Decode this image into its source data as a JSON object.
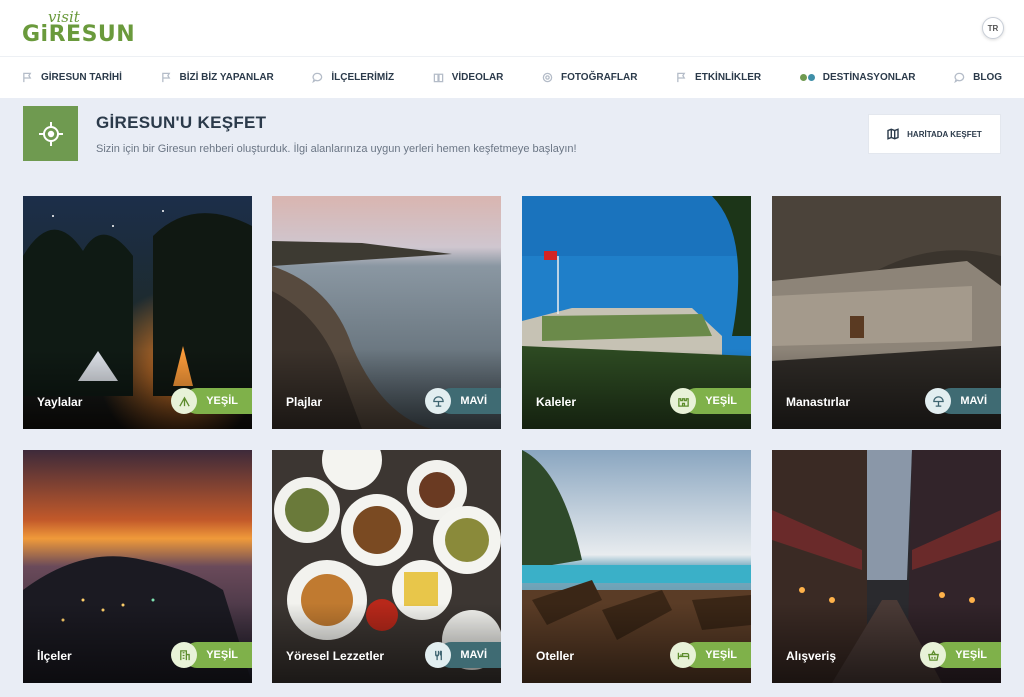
{
  "header": {
    "logo_script": "visit",
    "logo_brand": "GiRESUN",
    "lang": "TR"
  },
  "nav": {
    "items": [
      {
        "label": "GİRESUN TARİHİ",
        "icon": "flag-icon"
      },
      {
        "label": "BİZİ BİZ YAPANLAR",
        "icon": "flag-icon"
      },
      {
        "label": "İLÇELERİMİZ",
        "icon": "chat-icon"
      },
      {
        "label": "VİDEOLAR",
        "icon": "book-icon"
      },
      {
        "label": "FOTOĞRAFLAR",
        "icon": "camera-icon"
      },
      {
        "label": "ETKİNLİKLER",
        "icon": "flag-icon"
      },
      {
        "label": "DESTİNASYONLAR",
        "icon": "dots-icon"
      },
      {
        "label": "BLOG",
        "icon": "chat-icon"
      }
    ]
  },
  "page": {
    "title": "GİRESUN'U KEŞFET",
    "subtitle": "Sizin için bir Giresun rehberi oluşturduk. İlgi alanlarınıza uygun yerleri hemen keşfetmeye başlayın!",
    "map_button": "HARİTADA KEŞFET"
  },
  "colors": {
    "green": "#7fb14a",
    "blue": "#3f6b73",
    "hero": "#6f9a50",
    "bg": "#e9edf5"
  },
  "cards": [
    {
      "label": "Yaylalar",
      "badge": "YEŞİL",
      "tone": "green",
      "icon": "tent-icon"
    },
    {
      "label": "Plajlar",
      "badge": "MAVİ",
      "tone": "blue",
      "icon": "umbrella-icon"
    },
    {
      "label": "Kaleler",
      "badge": "YEŞİL",
      "tone": "green",
      "icon": "castle-icon"
    },
    {
      "label": "Manastırlar",
      "badge": "MAVİ",
      "tone": "blue",
      "icon": "umbrella-icon"
    },
    {
      "label": "İlçeler",
      "badge": "YEŞİL",
      "tone": "green",
      "icon": "building-icon"
    },
    {
      "label": "Yöresel Lezzetler",
      "badge": "MAVİ",
      "tone": "blue",
      "icon": "cutlery-icon"
    },
    {
      "label": "Oteller",
      "badge": "YEŞİL",
      "tone": "green",
      "icon": "bed-icon"
    },
    {
      "label": "Alışveriş",
      "badge": "YEŞİL",
      "tone": "green",
      "icon": "basket-icon"
    }
  ]
}
